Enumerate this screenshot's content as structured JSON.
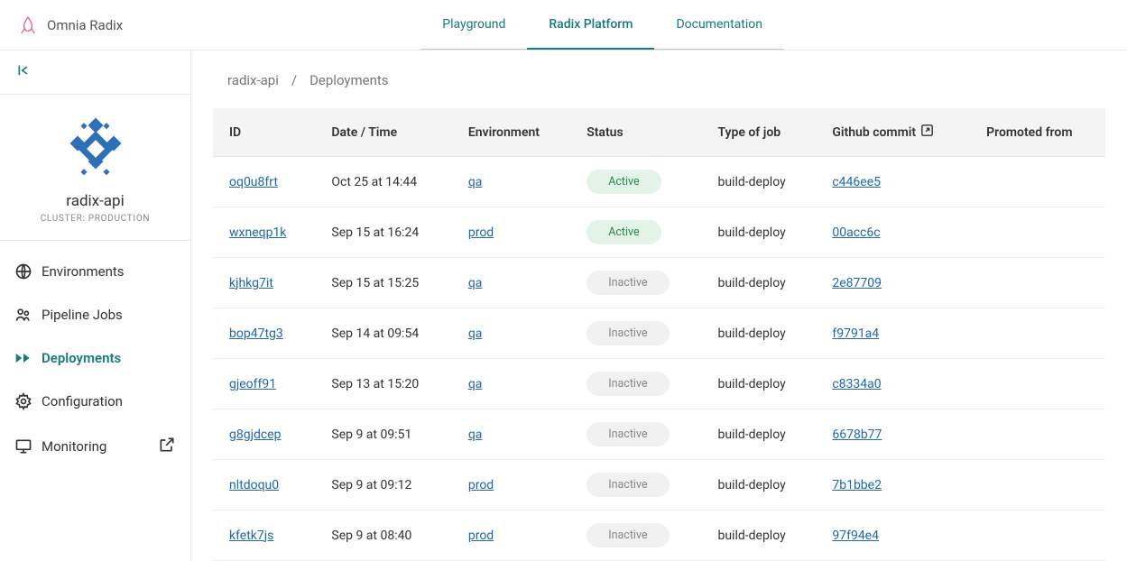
{
  "header": {
    "title": "Omnia Radix",
    "tabs": [
      {
        "label": "Playground",
        "active": false
      },
      {
        "label": "Radix Platform",
        "active": true
      },
      {
        "label": "Documentation",
        "active": false
      }
    ]
  },
  "sidebar": {
    "project": {
      "name": "radix-api",
      "cluster": "CLUSTER: PRODUCTION"
    },
    "nav": [
      {
        "label": "Environments",
        "icon": "globe"
      },
      {
        "label": "Pipeline Jobs",
        "icon": "people"
      },
      {
        "label": "Deployments",
        "icon": "deploy",
        "active": true
      },
      {
        "label": "Configuration",
        "icon": "gear"
      },
      {
        "label": "Monitoring",
        "icon": "monitor",
        "external": true
      }
    ]
  },
  "breadcrumb": {
    "app": "radix-api",
    "sep": "/",
    "page": "Deployments"
  },
  "table": {
    "columns": [
      "ID",
      "Date / Time",
      "Environment",
      "Status",
      "Type of job",
      "Github commit",
      "Promoted from"
    ],
    "rows": [
      {
        "id": "oq0u8frt",
        "date": "Oct 25 at 14:44",
        "env": "qa",
        "status": "Active",
        "job": "build-deploy",
        "commit": "c446ee5",
        "promoted": ""
      },
      {
        "id": "wxneqp1k",
        "date": "Sep 15 at 16:24",
        "env": "prod",
        "status": "Active",
        "job": "build-deploy",
        "commit": "00acc6c",
        "promoted": ""
      },
      {
        "id": "kjhkg7it",
        "date": "Sep 15 at 15:25",
        "env": "qa",
        "status": "Inactive",
        "job": "build-deploy",
        "commit": "2e87709",
        "promoted": ""
      },
      {
        "id": "bop47tg3",
        "date": "Sep 14 at 09:54",
        "env": "qa",
        "status": "Inactive",
        "job": "build-deploy",
        "commit": "f9791a4",
        "promoted": ""
      },
      {
        "id": "gjeoff91",
        "date": "Sep 13 at 15:20",
        "env": "qa",
        "status": "Inactive",
        "job": "build-deploy",
        "commit": "c8334a0",
        "promoted": ""
      },
      {
        "id": "g8gjdcep",
        "date": "Sep 9 at 09:51",
        "env": "qa",
        "status": "Inactive",
        "job": "build-deploy",
        "commit": "6678b77",
        "promoted": ""
      },
      {
        "id": "nltdoqu0",
        "date": "Sep 9 at 09:12",
        "env": "prod",
        "status": "Inactive",
        "job": "build-deploy",
        "commit": "7b1bbe2",
        "promoted": ""
      },
      {
        "id": "kfetk7js",
        "date": "Sep 9 at 08:40",
        "env": "prod",
        "status": "Inactive",
        "job": "build-deploy",
        "commit": "97f94e4",
        "promoted": ""
      }
    ]
  }
}
